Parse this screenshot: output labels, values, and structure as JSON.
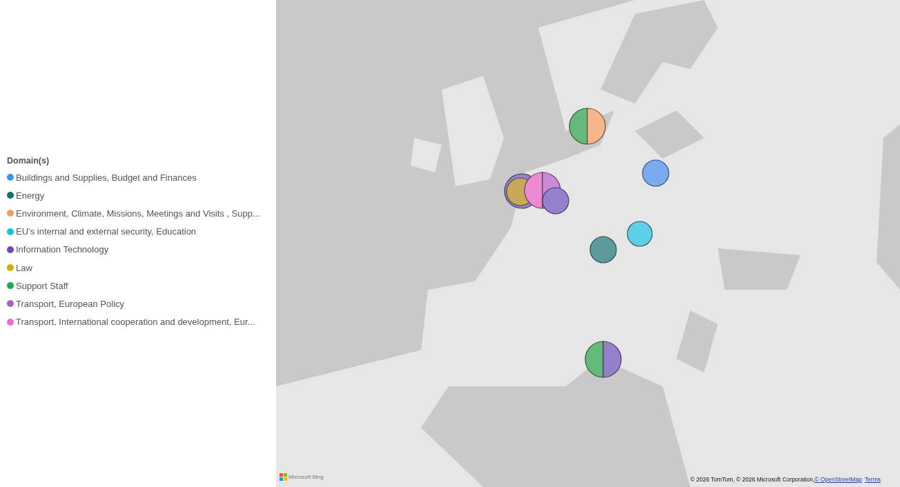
{
  "legend": {
    "title": "Domain(s)",
    "items": [
      {
        "label": "Buildings and Supplies, Budget and Finances",
        "color": "#3f8ff7"
      },
      {
        "label": "Energy",
        "color": "#12706e"
      },
      {
        "label": "Environment, Climate, Missions, Meetings and Visits , Supp...",
        "color": "#f49c5a"
      },
      {
        "label": "EU’s internal and external security, Education",
        "color": "#17c1ea"
      },
      {
        "label": "Information Technology",
        "color": "#7344c5"
      },
      {
        "label": "Law",
        "color": "#dbaa00"
      },
      {
        "label": "Support Staff",
        "color": "#1aaa4a"
      },
      {
        "label": "Transport, European Policy",
        "color": "#b657c6"
      },
      {
        "label": "Transport, International cooperation and development, Eur...",
        "color": "#f06ac8"
      }
    ]
  },
  "map": {
    "markers": [
      {
        "slices": [
          {
            "color": "#64ba7a"
          },
          {
            "color": "#f4b68a"
          }
        ]
      },
      {
        "slices": [
          {
            "color": "#7aaaf2"
          }
        ]
      },
      {
        "slices": [
          {
            "color": "#9580cc"
          }
        ]
      },
      {
        "slices": [
          {
            "color": "#c8a858"
          }
        ]
      },
      {
        "slices": [
          {
            "color": "#ec8ad3"
          },
          {
            "color": "#c98ad6"
          }
        ]
      },
      {
        "slices": [
          {
            "color": "#9580cc"
          }
        ]
      },
      {
        "slices": [
          {
            "color": "#5fcfe8"
          }
        ]
      },
      {
        "slices": [
          {
            "color": "#5e9a9a"
          }
        ]
      },
      {
        "slices": [
          {
            "color": "#64ba7a"
          },
          {
            "color": "#9580cc"
          }
        ]
      }
    ],
    "logo": "Microsoft Bing",
    "attribution": {
      "text": "© 2026 TomTom, © 2026 Microsoft Corporation, ",
      "links": [
        "© OpenStreetMap",
        "Terms"
      ]
    }
  }
}
